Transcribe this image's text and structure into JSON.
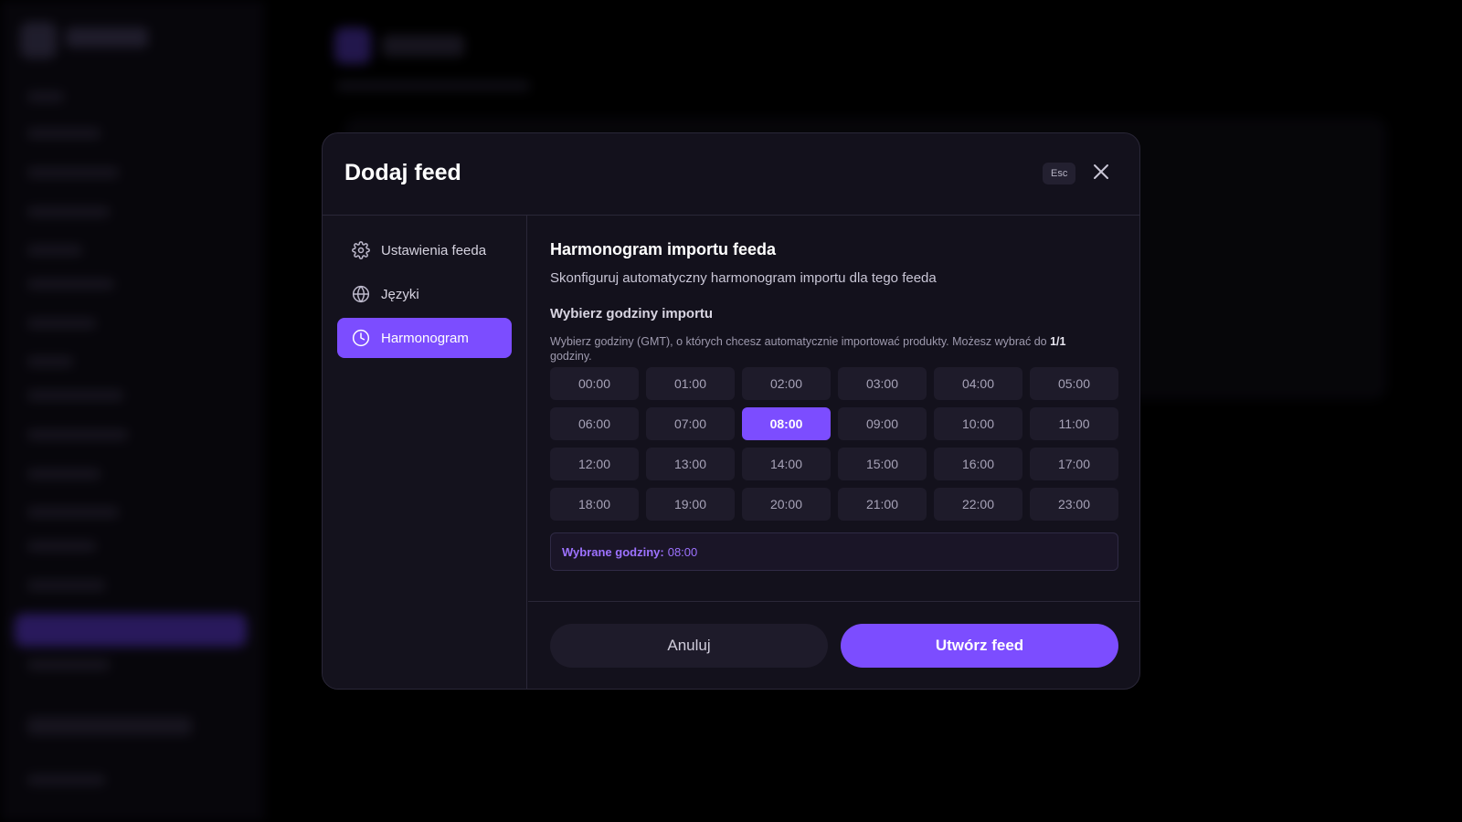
{
  "background": {
    "accent": "#7c4dff"
  },
  "modal": {
    "title": "Dodaj feed",
    "esc_label": "Esc",
    "close_icon": "close-icon"
  },
  "sidebar": {
    "items": [
      {
        "label": "Ustawienia feeda",
        "icon": "gear-icon",
        "active": false
      },
      {
        "label": "Języki",
        "icon": "globe-icon",
        "active": false
      },
      {
        "label": "Harmonogram",
        "icon": "clock-icon",
        "active": true
      }
    ]
  },
  "schedule": {
    "title": "Harmonogram importu feeda",
    "subtitle": "Skonfiguruj automatyczny harmonogram importu dla tego feeda",
    "pick_title": "Wybierz godziny importu",
    "hint_text": "Wybierz godziny (GMT), o których chcesz automatycznie importować produkty. Możesz wybrać do",
    "hint_limit": "1/1",
    "hint_suffix": "godziny.",
    "hours": [
      "00:00",
      "01:00",
      "02:00",
      "03:00",
      "04:00",
      "05:00",
      "06:00",
      "07:00",
      "08:00",
      "09:00",
      "10:00",
      "11:00",
      "12:00",
      "13:00",
      "14:00",
      "15:00",
      "16:00",
      "17:00",
      "18:00",
      "19:00",
      "20:00",
      "21:00",
      "22:00",
      "23:00"
    ],
    "selected_hours": [
      "08:00"
    ],
    "selected_label": "Wybrane godziny:",
    "selected_value": "08:00"
  },
  "footer": {
    "cancel_label": "Anuluj",
    "create_label": "Utwórz feed"
  }
}
